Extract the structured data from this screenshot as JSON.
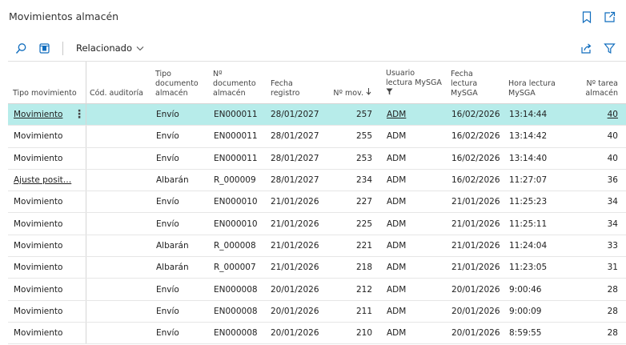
{
  "page": {
    "title": "Movimientos almacén",
    "icons": {
      "bookmark": "bookmark-icon",
      "open_new": "open-new-window-icon"
    }
  },
  "toolbar": {
    "search_icon": "search-icon",
    "edit_list_icon": "edit-list-icon",
    "related_label": "Relacionado",
    "share_icon": "share-icon",
    "filter_icon": "filter-icon"
  },
  "columns": {
    "tipo_movimiento": "Tipo movimiento",
    "cod_auditoria": "Cód. auditoría",
    "tipo_documento": "Tipo documento almacén",
    "num_documento": "Nº documento almacén",
    "fecha_registro": "Fecha registro",
    "num_mov": "Nº mov.",
    "usuario_lectura": "Usuario lectura MySGA",
    "fecha_lectura": "Fecha lectura MySGA",
    "hora_lectura": "Hora lectura MySGA",
    "num_tarea": "Nº tarea almacén"
  },
  "rows": [
    {
      "tipo": "Movimiento",
      "cod": "",
      "tipodoc": "Envío",
      "numdoc": "EN000011",
      "fecha": "28/01/2027",
      "nmov": "257",
      "usuario": "ADM",
      "fechalect": "16/02/2026",
      "hora": "13:14:44",
      "tarea": "40",
      "selected": true
    },
    {
      "tipo": "Movimiento",
      "cod": "",
      "tipodoc": "Envío",
      "numdoc": "EN000011",
      "fecha": "28/01/2027",
      "nmov": "255",
      "usuario": "ADM",
      "fechalect": "16/02/2026",
      "hora": "13:14:42",
      "tarea": "40"
    },
    {
      "tipo": "Movimiento",
      "cod": "",
      "tipodoc": "Envío",
      "numdoc": "EN000011",
      "fecha": "28/01/2027",
      "nmov": "253",
      "usuario": "ADM",
      "fechalect": "16/02/2026",
      "hora": "13:14:40",
      "tarea": "40"
    },
    {
      "tipo": "Ajuste posit…",
      "cod": "",
      "tipodoc": "Albarán",
      "numdoc": "R_000009",
      "fecha": "28/01/2027",
      "nmov": "234",
      "usuario": "ADM",
      "fechalect": "16/02/2026",
      "hora": "11:27:07",
      "tarea": "36"
    },
    {
      "tipo": "Movimiento",
      "cod": "",
      "tipodoc": "Envío",
      "numdoc": "EN000010",
      "fecha": "21/01/2026",
      "nmov": "227",
      "usuario": "ADM",
      "fechalect": "21/01/2026",
      "hora": "11:25:23",
      "tarea": "34"
    },
    {
      "tipo": "Movimiento",
      "cod": "",
      "tipodoc": "Envío",
      "numdoc": "EN000010",
      "fecha": "21/01/2026",
      "nmov": "225",
      "usuario": "ADM",
      "fechalect": "21/01/2026",
      "hora": "11:25:11",
      "tarea": "34"
    },
    {
      "tipo": "Movimiento",
      "cod": "",
      "tipodoc": "Albarán",
      "numdoc": "R_000008",
      "fecha": "21/01/2026",
      "nmov": "221",
      "usuario": "ADM",
      "fechalect": "21/01/2026",
      "hora": "11:24:04",
      "tarea": "33"
    },
    {
      "tipo": "Movimiento",
      "cod": "",
      "tipodoc": "Albarán",
      "numdoc": "R_000007",
      "fecha": "21/01/2026",
      "nmov": "218",
      "usuario": "ADM",
      "fechalect": "21/01/2026",
      "hora": "11:23:05",
      "tarea": "31"
    },
    {
      "tipo": "Movimiento",
      "cod": "",
      "tipodoc": "Envío",
      "numdoc": "EN000008",
      "fecha": "20/01/2026",
      "nmov": "212",
      "usuario": "ADM",
      "fechalect": "20/01/2026",
      "hora": "9:00:46",
      "tarea": "28"
    },
    {
      "tipo": "Movimiento",
      "cod": "",
      "tipodoc": "Envío",
      "numdoc": "EN000008",
      "fecha": "20/01/2026",
      "nmov": "211",
      "usuario": "ADM",
      "fechalect": "20/01/2026",
      "hora": "9:00:09",
      "tarea": "28"
    },
    {
      "tipo": "Movimiento",
      "cod": "",
      "tipodoc": "Envío",
      "numdoc": "EN000008",
      "fecha": "20/01/2026",
      "nmov": "210",
      "usuario": "ADM",
      "fechalect": "20/01/2026",
      "hora": "8:59:55",
      "tarea": "28"
    }
  ],
  "colors": {
    "selected_row": "#b7ecea",
    "accent": "#0f6cbd"
  }
}
